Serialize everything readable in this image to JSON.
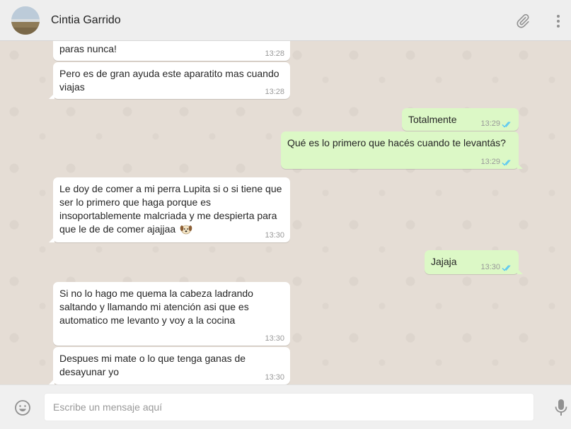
{
  "header": {
    "contact_name": "Cintia Garrido",
    "icons": [
      "avatar",
      "paperclip-icon",
      "menu-dots-icon"
    ]
  },
  "messages": [
    {
      "dir": "in",
      "text": "paras nunca!",
      "time": "13:28"
    },
    {
      "dir": "in",
      "text": "Pero es de gran ayuda este aparatito mas cuando viajas",
      "time": "13:28"
    },
    {
      "dir": "out",
      "text": "Totalmente",
      "time": "13:29",
      "status": "read"
    },
    {
      "dir": "out",
      "text": "Qué es lo primero que hacés cuando te levantás?",
      "time": "13:29",
      "status": "read"
    },
    {
      "dir": "in",
      "text": "Le doy de comer a mi perra Lupita si o si tiene que ser lo primero que haga porque es insoportablemente malcriada y me despierta para que le de de comer ajajjaa",
      "emoji": "dog-face",
      "time": "13:30"
    },
    {
      "dir": "out",
      "text": "Jajaja",
      "time": "13:30",
      "status": "read"
    },
    {
      "dir": "in",
      "text": "Si no lo hago me quema la cabeza ladrando saltando y llamando mi atención asi que es automatico me levanto y voy a la cocina",
      "time": "13:30"
    },
    {
      "dir": "in",
      "text": "Despues mi mate o lo que tenga ganas de desayunar yo",
      "time": "13:30"
    }
  ],
  "composer": {
    "placeholder": "Escribe un mensaje aquí",
    "value": ""
  },
  "colors": {
    "incoming_bubble": "#ffffff",
    "outgoing_bubble": "#dcf8c6",
    "read_ticks": "#4fc3f7",
    "chat_background": "#e5ddd5"
  }
}
